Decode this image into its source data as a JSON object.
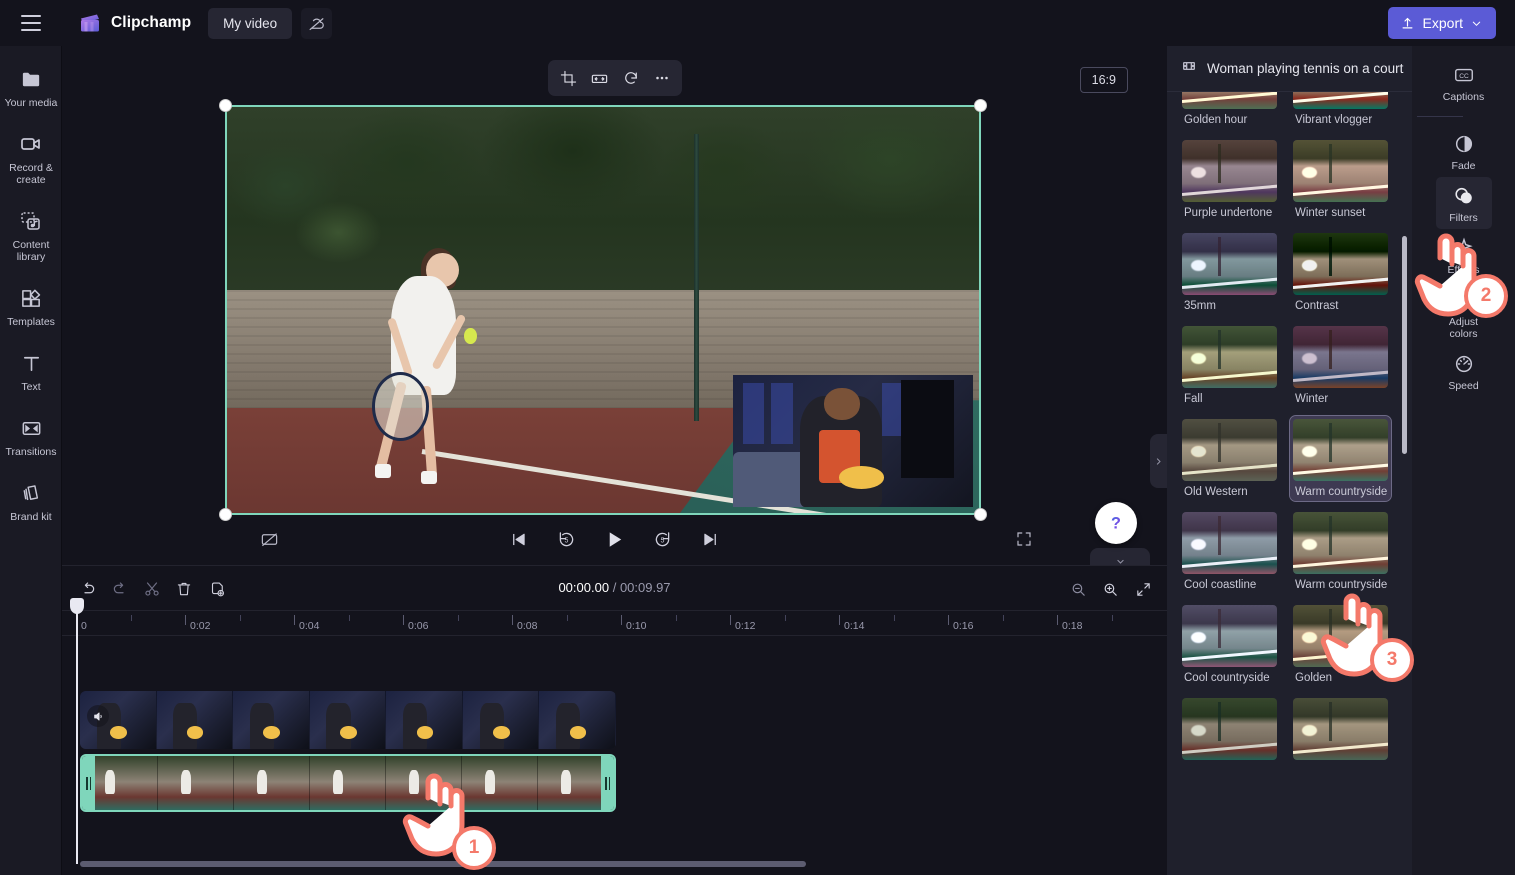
{
  "header": {
    "menu_icon": "hamburger-icon",
    "brand": "Clipchamp",
    "project_tab": "My video",
    "cloud_icon": "cloud-off-icon",
    "export_label": "Export",
    "export_icon": "upload-icon",
    "export_chevron": "chevron-down-icon",
    "export_color": "#5b5bd6"
  },
  "sidebar": {
    "items": [
      {
        "label": "Your media",
        "icon": "folder-icon"
      },
      {
        "label": "Record & create",
        "icon": "video-camera-icon"
      },
      {
        "label": "Content library",
        "icon": "media-library-icon"
      },
      {
        "label": "Templates",
        "icon": "templates-icon"
      },
      {
        "label": "Text",
        "icon": "text-icon"
      },
      {
        "label": "Transitions",
        "icon": "transitions-icon"
      },
      {
        "label": "Brand kit",
        "icon": "brand-kit-icon"
      }
    ],
    "collapse_icon": "chevron-right-icon"
  },
  "preview": {
    "float_toolbar": [
      {
        "name": "crop-button",
        "icon": "crop-icon"
      },
      {
        "name": "flip-button",
        "icon": "flip-horizontal-icon"
      },
      {
        "name": "rotate-button",
        "icon": "rotate-icon"
      },
      {
        "name": "more-options-button",
        "icon": "ellipsis-icon"
      }
    ],
    "aspect_ratio": "16:9",
    "controls": {
      "captions_off": "captions-off-icon",
      "skip_start": "skip-to-start-icon",
      "rewind": "rewind-5s-icon",
      "play": "play-icon",
      "forward": "forward-5s-icon",
      "skip_end": "skip-to-end-icon",
      "fullscreen": "fullscreen-icon"
    },
    "help_icon": "question-mark-icon",
    "collapse_icon": "chevron-down-icon",
    "selection_color": "#7fd6bb"
  },
  "timeline": {
    "toolbar": [
      {
        "name": "undo-button",
        "icon": "undo-icon"
      },
      {
        "name": "redo-button",
        "icon": "redo-icon"
      },
      {
        "name": "split-button",
        "icon": "scissors-icon"
      },
      {
        "name": "delete-button",
        "icon": "trash-icon"
      },
      {
        "name": "duplicate-button",
        "icon": "duplicate-icon"
      }
    ],
    "current_time": "00:00.00",
    "separator": "/",
    "total_time": "00:09.97",
    "zoom_out_icon": "zoom-out-icon",
    "zoom_in_icon": "zoom-in-icon",
    "fit_icon": "fit-to-screen-icon",
    "ruler_labels": [
      "0",
      "0:02",
      "0:04",
      "0:06",
      "0:08",
      "0:10",
      "0:12",
      "0:14",
      "0:16",
      "0:18"
    ],
    "clips": [
      {
        "name": "clip-overlay-video",
        "selected": false,
        "audio_icon": "speaker-icon"
      },
      {
        "name": "clip-main-video",
        "selected": true,
        "trim_handle_icon": "trim-handle-icon"
      }
    ]
  },
  "filters_panel": {
    "header_icon": "film-strip-icon",
    "title": "Woman playing tennis on a court",
    "selected_filter": "Warm countryside",
    "filters": [
      {
        "label": "Golden hour",
        "css": "sepia(.45) saturate(1.3) hue-rotate(-12deg) brightness(1.02)"
      },
      {
        "label": "Vibrant vlogger",
        "css": "saturate(1.6) contrast(1.12) brightness(1.05)"
      },
      {
        "label": "Purple undertone",
        "css": "hue-rotate(275deg) saturate(.85) brightness(.95)"
      },
      {
        "label": "Winter sunset",
        "css": "sepia(.3) hue-rotate(-20deg) saturate(1.25) brightness(1.04)"
      },
      {
        "label": "35mm",
        "css": "hue-rotate(150deg) saturate(1.1) contrast(1.05)"
      },
      {
        "label": "Contrast",
        "css": "contrast(1.45) saturate(1.15) brightness(.94)"
      },
      {
        "label": "Fall",
        "css": "sepia(.35) hue-rotate(18deg) saturate(1.3)"
      },
      {
        "label": "Winter",
        "css": "hue-rotate(215deg) saturate(1.5) brightness(.82)"
      },
      {
        "label": "Old Western",
        "css": "sepia(.7) saturate(.75) contrast(.95) brightness(.92)"
      },
      {
        "label": "Warm countryside",
        "css": "sepia(.18) saturate(1.08) brightness(1.06)"
      },
      {
        "label": "Cool coastline",
        "css": "hue-rotate(170deg) saturate(.95) brightness(1.05)"
      },
      {
        "label": "Warm countryside",
        "css": "sepia(.22) saturate(1.12) brightness(1.03)"
      },
      {
        "label": "Cool countryside",
        "css": "hue-rotate(155deg) saturate(.9) brightness(1.08)"
      },
      {
        "label": "Golden",
        "css": "sepia(.5) hue-rotate(-8deg) saturate(1.2) brightness(.98)"
      },
      {
        "label": "",
        "css": "saturate(1.2) brightness(.9)"
      },
      {
        "label": "",
        "css": "sepia(.4) brightness(.95)"
      }
    ]
  },
  "properties_rail": {
    "items": [
      {
        "label": "Captions",
        "icon": "closed-captions-icon",
        "active": false,
        "separator_after": true
      },
      {
        "label": "Fade",
        "icon": "fade-icon",
        "active": false
      },
      {
        "label": "Filters",
        "icon": "filters-icon",
        "active": true
      },
      {
        "label": "Effects",
        "icon": "effects-icon",
        "active": false
      },
      {
        "label": "Adjust colors",
        "icon": "adjust-colors-icon",
        "active": false
      },
      {
        "label": "Speed",
        "icon": "speed-icon",
        "active": false
      }
    ]
  },
  "callouts": {
    "color": "#f4796a",
    "steps": [
      {
        "number": "1",
        "target": "timeline clip"
      },
      {
        "number": "2",
        "target": "Filters tab"
      },
      {
        "number": "3",
        "target": "Warm countryside filter"
      }
    ]
  }
}
